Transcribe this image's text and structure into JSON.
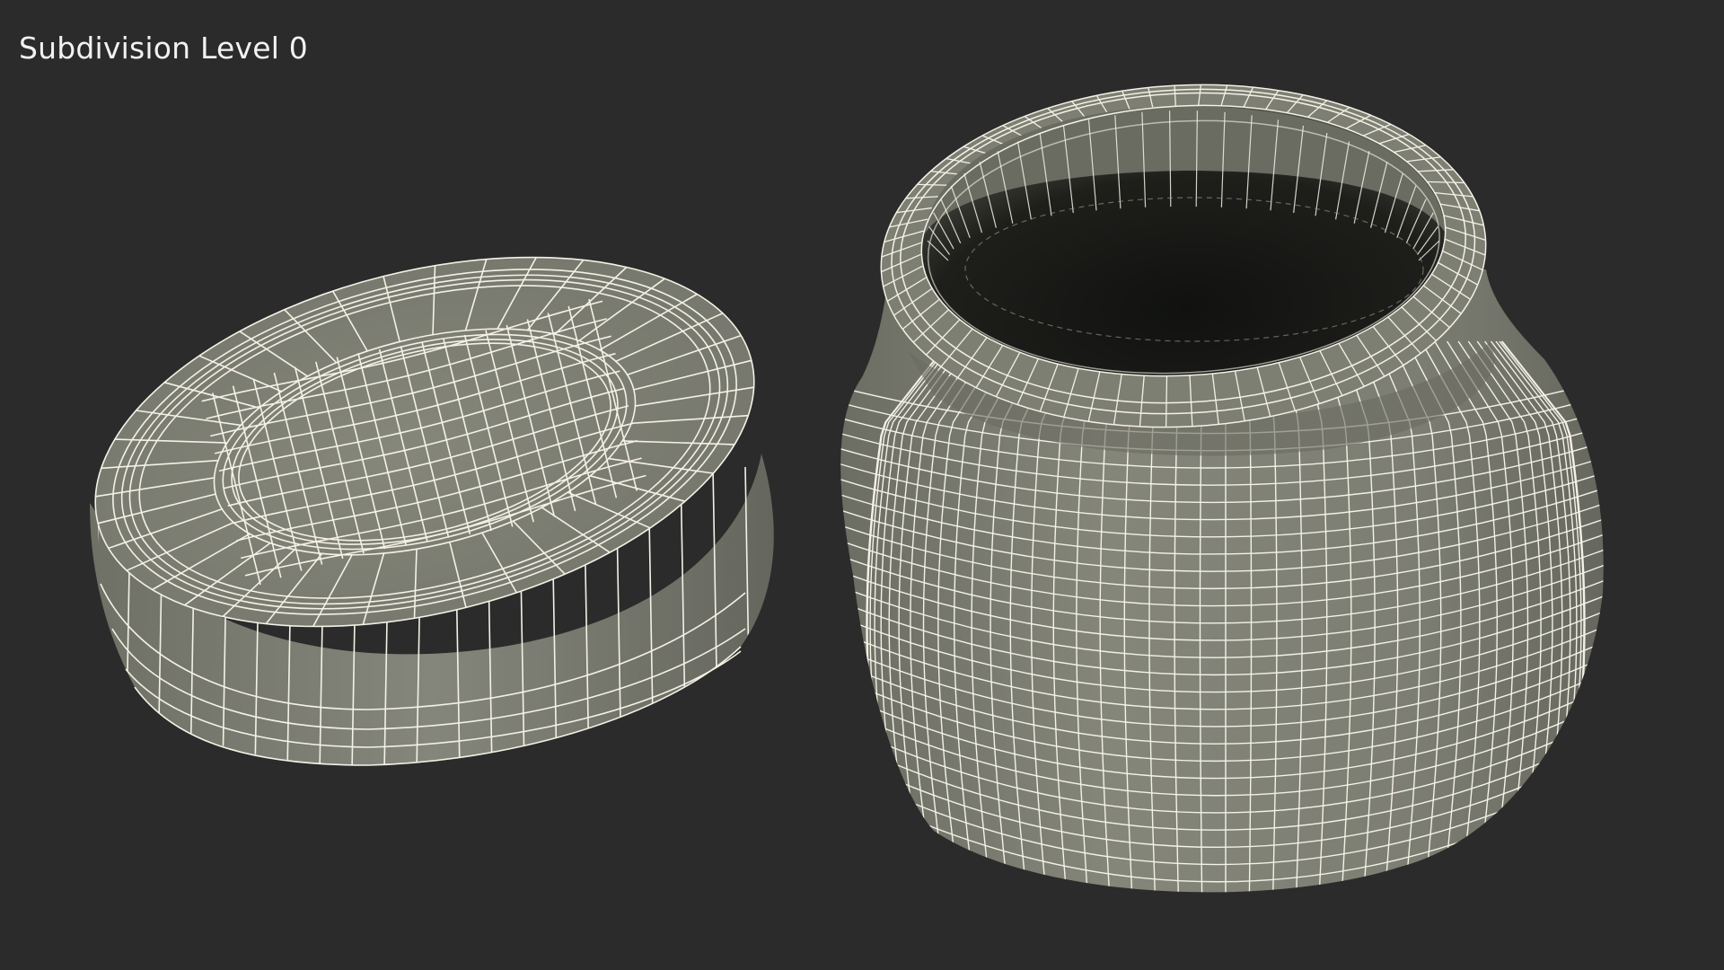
{
  "viewport": {
    "overlay_label": "Subdivision Level 0",
    "background_color": "#2b2b2b"
  },
  "objects": [
    {
      "name": "jar-lid",
      "display": "wireframe"
    },
    {
      "name": "jar-body",
      "display": "wireframe"
    }
  ],
  "colors": {
    "surface": "#7c7d72",
    "surface_dark": "#5f6057",
    "interior": "#1c1d1a",
    "wire": "#f4f1e6"
  }
}
